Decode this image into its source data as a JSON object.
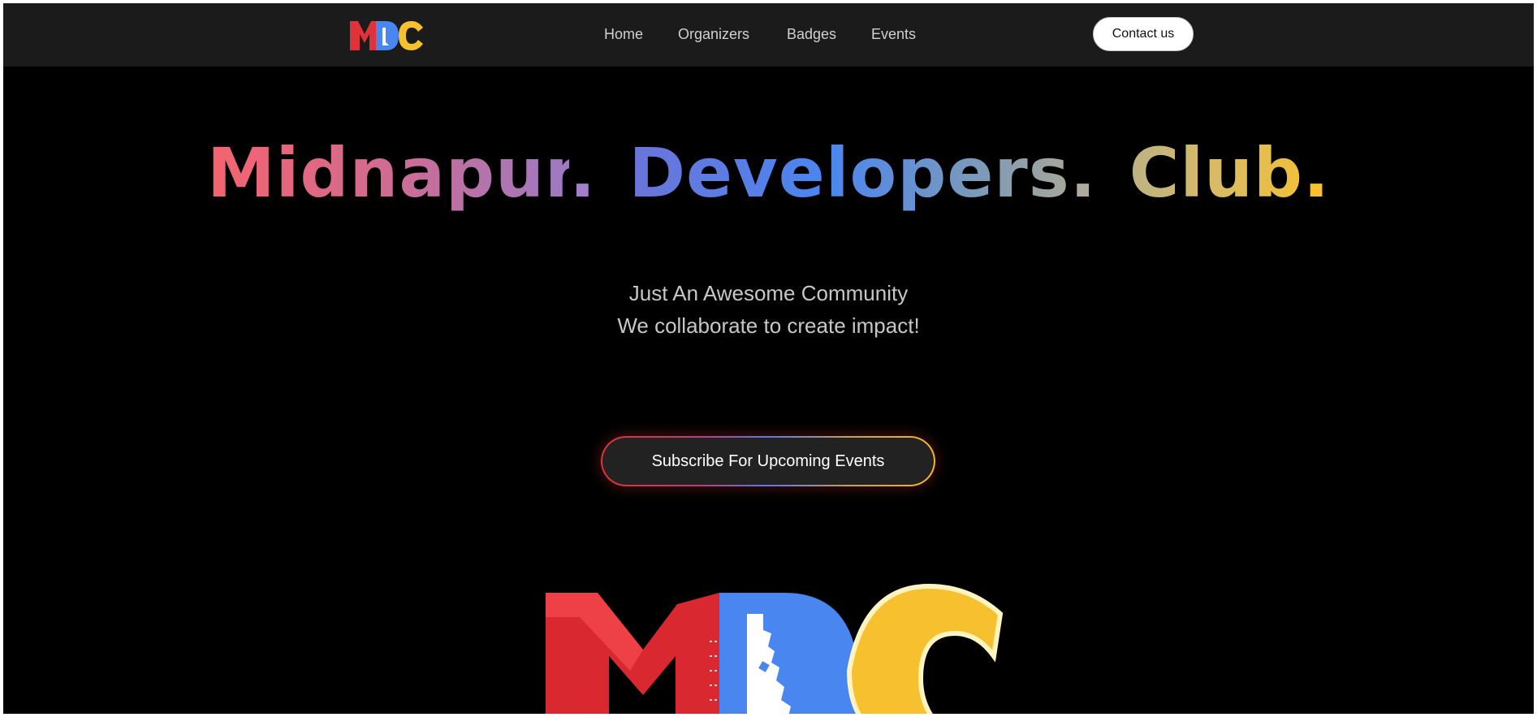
{
  "navbar": {
    "logo_icon": "mdc-logo-icon",
    "links": [
      {
        "label": "Home"
      },
      {
        "label": "Organizers"
      },
      {
        "label": "Badges"
      },
      {
        "label": "Events"
      }
    ],
    "contact_label": "Contact us"
  },
  "hero": {
    "title_words": [
      "Midnapur",
      "Developers",
      "Club"
    ],
    "title_dot": ".",
    "tagline_line1": "Just An Awesome Community",
    "tagline_line2": "We collaborate to create impact!",
    "subscribe_label": "Subscribe For Upcoming Events",
    "big_logo_icon": "mdc-large-logo-icon"
  },
  "colors": {
    "background": "#000000",
    "navbar": "#1b1b1b",
    "red": "#e0323a",
    "blue": "#4a86f0",
    "yellow": "#f6c02e"
  }
}
